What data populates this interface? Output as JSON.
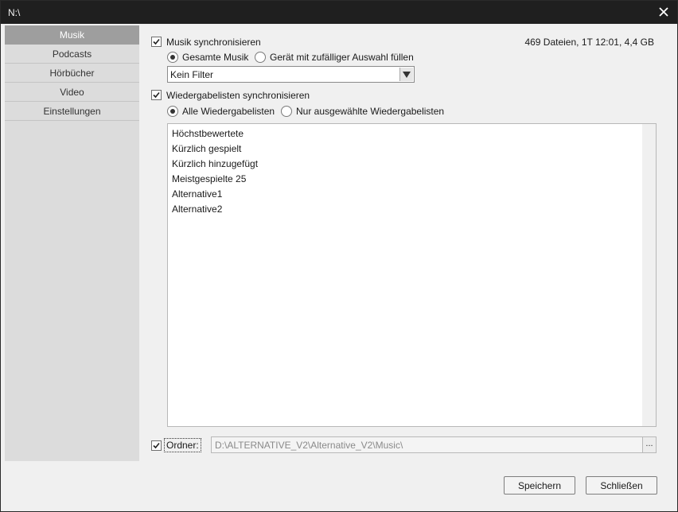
{
  "window": {
    "title": "N:\\"
  },
  "sidebar": {
    "items": [
      {
        "label": "Musik",
        "active": true
      },
      {
        "label": "Podcasts"
      },
      {
        "label": "Hörbücher"
      },
      {
        "label": "Video"
      },
      {
        "label": "Einstellungen"
      }
    ]
  },
  "music_sync": {
    "label": "Musik synchronisieren",
    "checked": true,
    "stats": "469 Dateien, 1T 12:01, 4,4 GB",
    "radio_all": "Gesamte Musik",
    "radio_random": "Gerät mit zufälliger Auswahl füllen",
    "selected_mode": "Gesamte Musik"
  },
  "filter": {
    "value": "Kein Filter"
  },
  "playlist_sync": {
    "label": "Wiedergabelisten synchronisieren",
    "checked": true,
    "radio_all": "Alle Wiedergabelisten",
    "radio_selected": "Nur ausgewählte Wiedergabelisten",
    "selected_mode": "Alle Wiedergabelisten"
  },
  "playlists": [
    "Höchstbewertete",
    "Kürzlich gespielt",
    "Kürzlich hinzugefügt",
    "Meistgespielte 25",
    "Alternative1",
    "Alternative2"
  ],
  "folder": {
    "label": "Ordner:",
    "checked": true,
    "path": "D:\\ALTERNATIVE_V2\\Alternative_V2\\Music\\",
    "browse_label": "..."
  },
  "buttons": {
    "save": "Speichern",
    "close": "Schließen"
  }
}
